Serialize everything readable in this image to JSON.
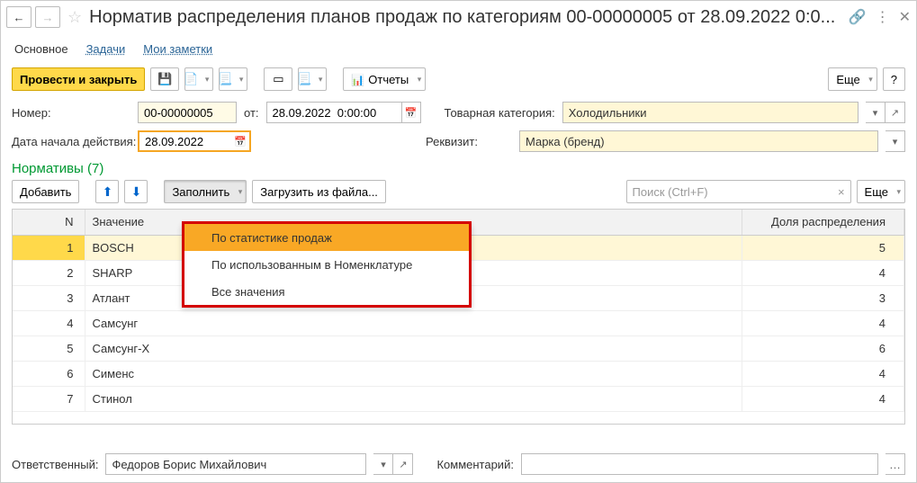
{
  "title": "Норматив распределения планов продаж по категориям 00-00000005 от 28.09.2022 0:0...",
  "tabs": [
    {
      "label": "Основное",
      "active": true
    },
    {
      "label": "Задачи",
      "active": false
    },
    {
      "label": "Мои заметки",
      "active": false
    }
  ],
  "toolbar": {
    "post_and_close": "Провести и закрыть",
    "reports": "Отчеты",
    "more": "Еще",
    "help": "?"
  },
  "fields": {
    "number_label": "Номер:",
    "number_value": "00-00000005",
    "from_label": "от:",
    "date_value": "28.09.2022  0:00:00",
    "category_label": "Товарная категория:",
    "category_value": "Холодильники",
    "start_date_label": "Дата начала действия:",
    "start_date_value": "28.09.2022",
    "requisite_label": "Реквизит:",
    "requisite_value": "Марка (бренд)"
  },
  "section_title": "Нормативы (7)",
  "grid_toolbar": {
    "add": "Добавить",
    "fill": "Заполнить",
    "load_from_file": "Загрузить из файла...",
    "search_placeholder": "Поиск (Ctrl+F)",
    "more": "Еще"
  },
  "dropdown_items": [
    {
      "label": "По статистике продаж",
      "highlighted": true
    },
    {
      "label": "По использованным в Номенклатуре",
      "highlighted": false
    },
    {
      "label": "Все значения",
      "highlighted": false
    }
  ],
  "grid": {
    "columns": [
      "N",
      "Значение",
      "Доля распределения"
    ],
    "rows": [
      {
        "n": 1,
        "value": "BOSCH",
        "share": 5,
        "selected": true
      },
      {
        "n": 2,
        "value": "SHARP",
        "share": 4
      },
      {
        "n": 3,
        "value": "Атлант",
        "share": 3
      },
      {
        "n": 4,
        "value": "Самсунг",
        "share": 4
      },
      {
        "n": 5,
        "value": "Самсунг-Х",
        "share": 6
      },
      {
        "n": 6,
        "value": "Сименс",
        "share": 4
      },
      {
        "n": 7,
        "value": "Стинол",
        "share": 4
      }
    ]
  },
  "footer": {
    "responsible_label": "Ответственный:",
    "responsible_value": "Федоров Борис Михайлович",
    "comment_label": "Комментарий:"
  }
}
